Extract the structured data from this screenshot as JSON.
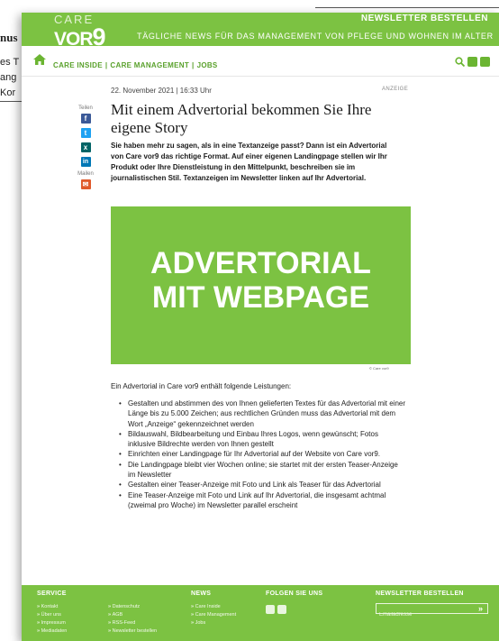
{
  "background_fragment": {
    "line1": "nus",
    "line2": "es T",
    "line3": "ang",
    "line4": "Kor"
  },
  "header": {
    "logo_care": "CARE",
    "logo_vor": "VOR",
    "logo_nine": "9",
    "newsletter_link": "NEWSLETTER BESTELLEN",
    "tagline": "TÄGLICHE NEWS FÜR DAS MANAGEMENT VON PFLEGE UND WOHNEN IM ALTER"
  },
  "nav": {
    "items": [
      "CARE INSIDE",
      "CARE MANAGEMENT",
      "JOBS"
    ],
    "separator": "|"
  },
  "share": {
    "label_share": "Teilen",
    "label_mail": "Mailen",
    "icons": [
      {
        "name": "facebook-icon",
        "glyph": "f",
        "color": "#3b5998"
      },
      {
        "name": "twitter-icon",
        "glyph": "t",
        "color": "#1da1f2"
      },
      {
        "name": "xing-icon",
        "glyph": "x",
        "color": "#026466"
      },
      {
        "name": "linkedin-icon",
        "glyph": "in",
        "color": "#0077b5"
      },
      {
        "name": "mail-icon",
        "glyph": "✉",
        "color": "#e05a2b"
      }
    ]
  },
  "article": {
    "meta": "22. November 2021 | 16:33 Uhr",
    "badge": "ANZEIGE",
    "title": "Mit einem Advertorial bekommen Sie Ihre eigene Story",
    "lead": "Sie haben mehr zu sagen, als in eine Textanzeige passt? Dann ist ein Advertorial von Care vor9 das richtige Format. Auf einer eigenen Landingpage stellen wir Ihr Produkt oder Ihre Dienstleistung in den Mittelpunkt, beschreiben sie im journalistischen Stil. Textanzeigen im Newsletter linken auf Ihr Advertorial.",
    "hero_line1": "ADVERTORIAL",
    "hero_line2": "MIT WEBPAGE",
    "credit": "© Care vor9",
    "intro": "Ein Advertorial in Care vor9 enthält folgende Leistungen:",
    "bullets": [
      "Gestalten und abstimmen des von Ihnen gelieferten Textes für das Advertorial mit einer Länge bis zu 5.000 Zeichen; aus rechtlichen Gründen muss das Advertorial mit dem Wort „Anzeige“ gekennzeichnet werden",
      "Bildauswahl, Bildbearbeitung und Einbau Ihres Logos, wenn gewünscht; Fotos inklusive Bildrechte werden von Ihnen gestellt",
      "Einrichten einer Landingpage für Ihr Advertorial auf der Website von Care vor9.",
      "Die Landingpage bleibt vier Wochen online; sie startet mit der ersten Teaser-Anzeige im Newsletter",
      "Gestalten einer Teaser-Anzeige mit Foto und Link als Teaser für das Advertorial",
      "Eine Teaser-Anzeige mit Foto und Link auf Ihr Advertorial, die insgesamt achtmal (zweimal pro Woche) im Newsletter parallel erscheint"
    ]
  },
  "footer": {
    "service_head": "SERVICE",
    "service_col1": [
      "Kontakt",
      "Über uns",
      "Impressum",
      "Mediadaten"
    ],
    "service_col2": [
      "Datenschutz",
      "AGB",
      "RSS-Feed",
      "Newsletter bestellen"
    ],
    "news_head": "NEWS",
    "news_items": [
      "Care Inside",
      "Care Management",
      "Jobs"
    ],
    "follow_head": "FOLGEN SIE UNS",
    "newsletter_head": "NEWSLETTER BESTELLEN",
    "email_placeholder": "Emailadresse",
    "submit": "»"
  },
  "colors": {
    "brand_green": "#7cc242",
    "link_green": "#5aa12c"
  }
}
